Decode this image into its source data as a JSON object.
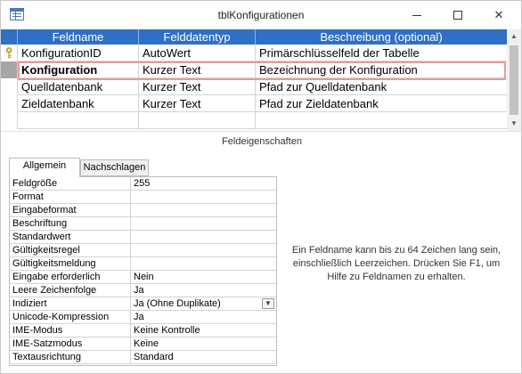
{
  "window": {
    "title": "tblKonfigurationen",
    "accent": "#2f70c4"
  },
  "grid": {
    "headers": {
      "name": "Feldname",
      "type": "Felddatentyp",
      "desc": "Beschreibung (optional)"
    },
    "rows": [
      {
        "name": "KonfigurationID",
        "type": "AutoWert",
        "desc": "Primärschlüsselfeld der Tabelle",
        "primary_key": true
      },
      {
        "name": "Konfiguration",
        "type": "Kurzer Text",
        "desc": "Bezeichnung der Konfiguration",
        "selected": true
      },
      {
        "name": "Quelldatenbank",
        "type": "Kurzer Text",
        "desc": "Pfad zur Quelldatenbank"
      },
      {
        "name": "Zieldatenbank",
        "type": "Kurzer Text",
        "desc": "Pfad zur Zieldatenbank"
      },
      {
        "name": "",
        "type": "",
        "desc": ""
      },
      {
        "name": "",
        "type": "",
        "desc": ""
      }
    ]
  },
  "properties": {
    "section_title": "Feldeigenschaften",
    "tabs": [
      "Allgemein",
      "Nachschlagen"
    ],
    "active_tab": "Allgemein",
    "rows": [
      {
        "label": "Feldgröße",
        "value": "255"
      },
      {
        "label": "Format",
        "value": ""
      },
      {
        "label": "Eingabeformat",
        "value": ""
      },
      {
        "label": "Beschriftung",
        "value": ""
      },
      {
        "label": "Standardwert",
        "value": ""
      },
      {
        "label": "Gültigkeitsregel",
        "value": ""
      },
      {
        "label": "Gültigkeitsmeldung",
        "value": ""
      },
      {
        "label": "Eingabe erforderlich",
        "value": "Nein"
      },
      {
        "label": "Leere Zeichenfolge",
        "value": "Ja"
      },
      {
        "label": "Indiziert",
        "value": "Ja (Ohne Duplikate)",
        "dropdown": true
      },
      {
        "label": "Unicode-Kompression",
        "value": "Ja"
      },
      {
        "label": "IME-Modus",
        "value": "Keine Kontrolle"
      },
      {
        "label": "IME-Satzmodus",
        "value": "Keine"
      },
      {
        "label": "Textausrichtung",
        "value": "Standard"
      }
    ],
    "help_text": "Ein Feldname kann bis zu 64 Zeichen lang sein, einschließlich Leerzeichen. Drücken Sie F1, um Hilfe zu Feldnamen zu erhalten."
  }
}
